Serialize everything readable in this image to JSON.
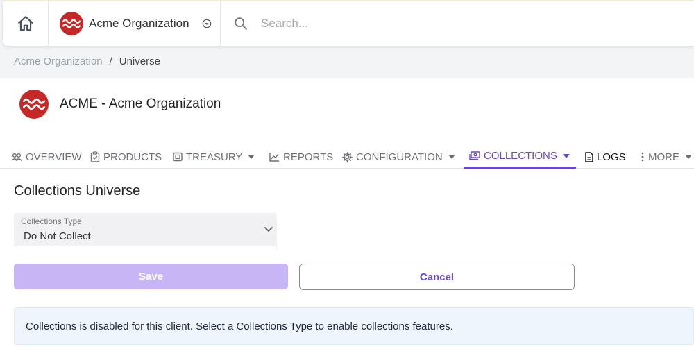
{
  "topbar": {
    "org_name": "Acme Organization",
    "search_placeholder": "Search..."
  },
  "breadcrumb": {
    "parent": "Acme Organization",
    "separator": "/",
    "current": "Universe"
  },
  "header": {
    "title": "ACME - Acme Organization"
  },
  "tabs": [
    {
      "label": "OVERVIEW",
      "icon": "people-icon",
      "dropdown": false
    },
    {
      "label": "PRODUCTS",
      "icon": "clipboard-icon",
      "dropdown": false
    },
    {
      "label": "TREASURY",
      "icon": "receipt-icon",
      "dropdown": true
    },
    {
      "label": "REPORTS",
      "icon": "line-chart-icon",
      "dropdown": false
    },
    {
      "label": "CONFIGURATION",
      "icon": "gear-icon",
      "dropdown": true
    },
    {
      "label": "COLLECTIONS",
      "icon": "money-icon",
      "dropdown": true,
      "active": true
    },
    {
      "label": "LOGS",
      "icon": "document-icon",
      "dropdown": false
    },
    {
      "label": "MORE",
      "icon": "more-vertical-icon",
      "dropdown": true
    }
  ],
  "content": {
    "section_title": "Collections Universe",
    "collections_type": {
      "label": "Collections Type",
      "value": "Do Not Collect"
    },
    "save_label": "Save",
    "cancel_label": "Cancel",
    "info_message": "Collections is disabled for this client. Select a Collections Type to enable collections features."
  },
  "colors": {
    "accent": "#6b48c8",
    "save_disabled": "#c7b5f5",
    "logo_red": "#c62828",
    "info_bg": "#eef5fd"
  }
}
